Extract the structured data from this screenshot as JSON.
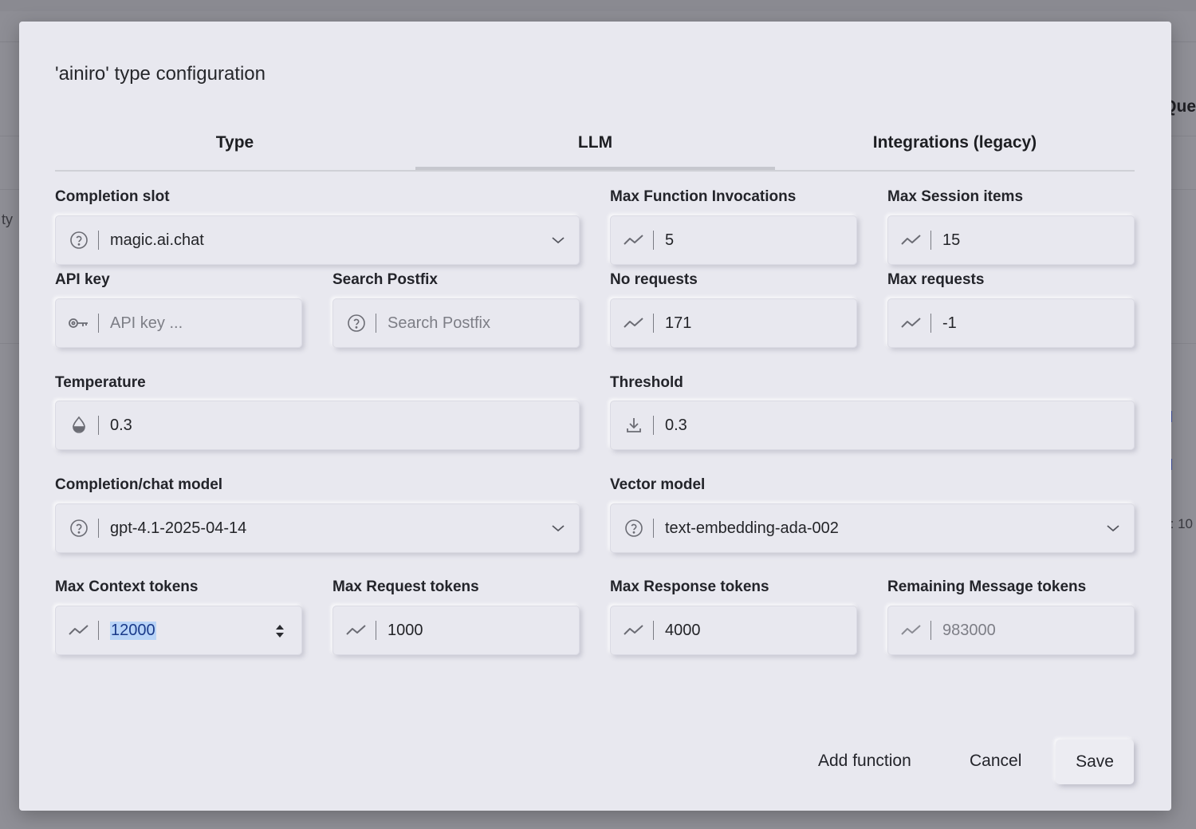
{
  "background": {
    "right_text": "Que",
    "left_text": "ty",
    "right_number": ": 10"
  },
  "dialog": {
    "title": "'ainiro' type configuration",
    "tabs": [
      {
        "label": "Type",
        "active": false
      },
      {
        "label": "LLM",
        "active": true
      },
      {
        "label": "Integrations (legacy)",
        "active": false
      }
    ],
    "fields": {
      "completion_slot": {
        "label": "Completion slot",
        "value": "magic.ai.chat",
        "icon": "help-circle-icon"
      },
      "max_function_invocations": {
        "label": "Max Function Invocations",
        "value": "5",
        "icon": "trend-icon"
      },
      "max_session_items": {
        "label": "Max Session items",
        "value": "15",
        "icon": "trend-icon"
      },
      "api_key": {
        "label": "API key",
        "placeholder": "API key ...",
        "icon": "key-icon"
      },
      "search_postfix": {
        "label": "Search Postfix",
        "placeholder": "Search Postfix",
        "icon": "help-circle-icon"
      },
      "no_requests": {
        "label": "No requests",
        "value": "171",
        "icon": "trend-icon"
      },
      "max_requests": {
        "label": "Max requests",
        "value": "-1",
        "icon": "trend-icon"
      },
      "temperature": {
        "label": "Temperature",
        "value": "0.3",
        "icon": "drop-icon"
      },
      "threshold": {
        "label": "Threshold",
        "value": "0.3",
        "icon": "download-icon"
      },
      "completion_model": {
        "label": "Completion/chat model",
        "value": "gpt-4.1-2025-04-14",
        "icon": "help-circle-icon"
      },
      "vector_model": {
        "label": "Vector model",
        "value": "text-embedding-ada-002",
        "icon": "help-circle-icon"
      },
      "max_context_tokens": {
        "label": "Max Context tokens",
        "value": "12000",
        "icon": "trend-icon"
      },
      "max_request_tokens": {
        "label": "Max Request tokens",
        "value": "1000",
        "icon": "trend-icon"
      },
      "max_response_tokens": {
        "label": "Max Response tokens",
        "value": "4000",
        "icon": "trend-icon"
      },
      "remaining_message_tokens": {
        "label": "Remaining Message tokens",
        "value": "983000",
        "icon": "trend-icon"
      }
    },
    "actions": {
      "add_function": "Add function",
      "cancel": "Cancel",
      "save": "Save"
    }
  }
}
